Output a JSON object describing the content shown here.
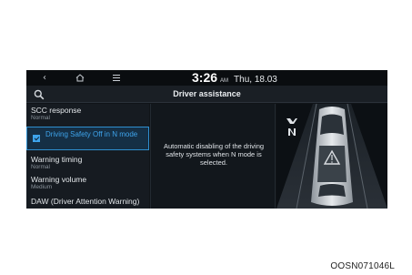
{
  "status_bar": {
    "time": "3:26",
    "ampm": "AM",
    "date": "Thu, 18.03"
  },
  "header": {
    "title": "Driver assistance"
  },
  "menu": {
    "items": [
      {
        "label": "SCC response",
        "value": "Normal"
      },
      {
        "label": "Driving Safety Off in N mode",
        "checked": true,
        "selected": true
      },
      {
        "label": "Warning timing",
        "value": "Normal"
      },
      {
        "label": "Warning volume",
        "value": "Medium"
      },
      {
        "label": "DAW (Driver Attention Warning)"
      }
    ]
  },
  "info": {
    "description": "Automatic disabling of the driving safety systems when N mode is selected."
  },
  "icons": {
    "back": "back-arrow-icon",
    "home": "home-icon",
    "menu": "menu-icon",
    "search": "search-icon",
    "mode": "n-mode-icon"
  },
  "colors": {
    "accent": "#3ea4ec",
    "background": "#101418"
  },
  "caption": "OOSN071046L"
}
